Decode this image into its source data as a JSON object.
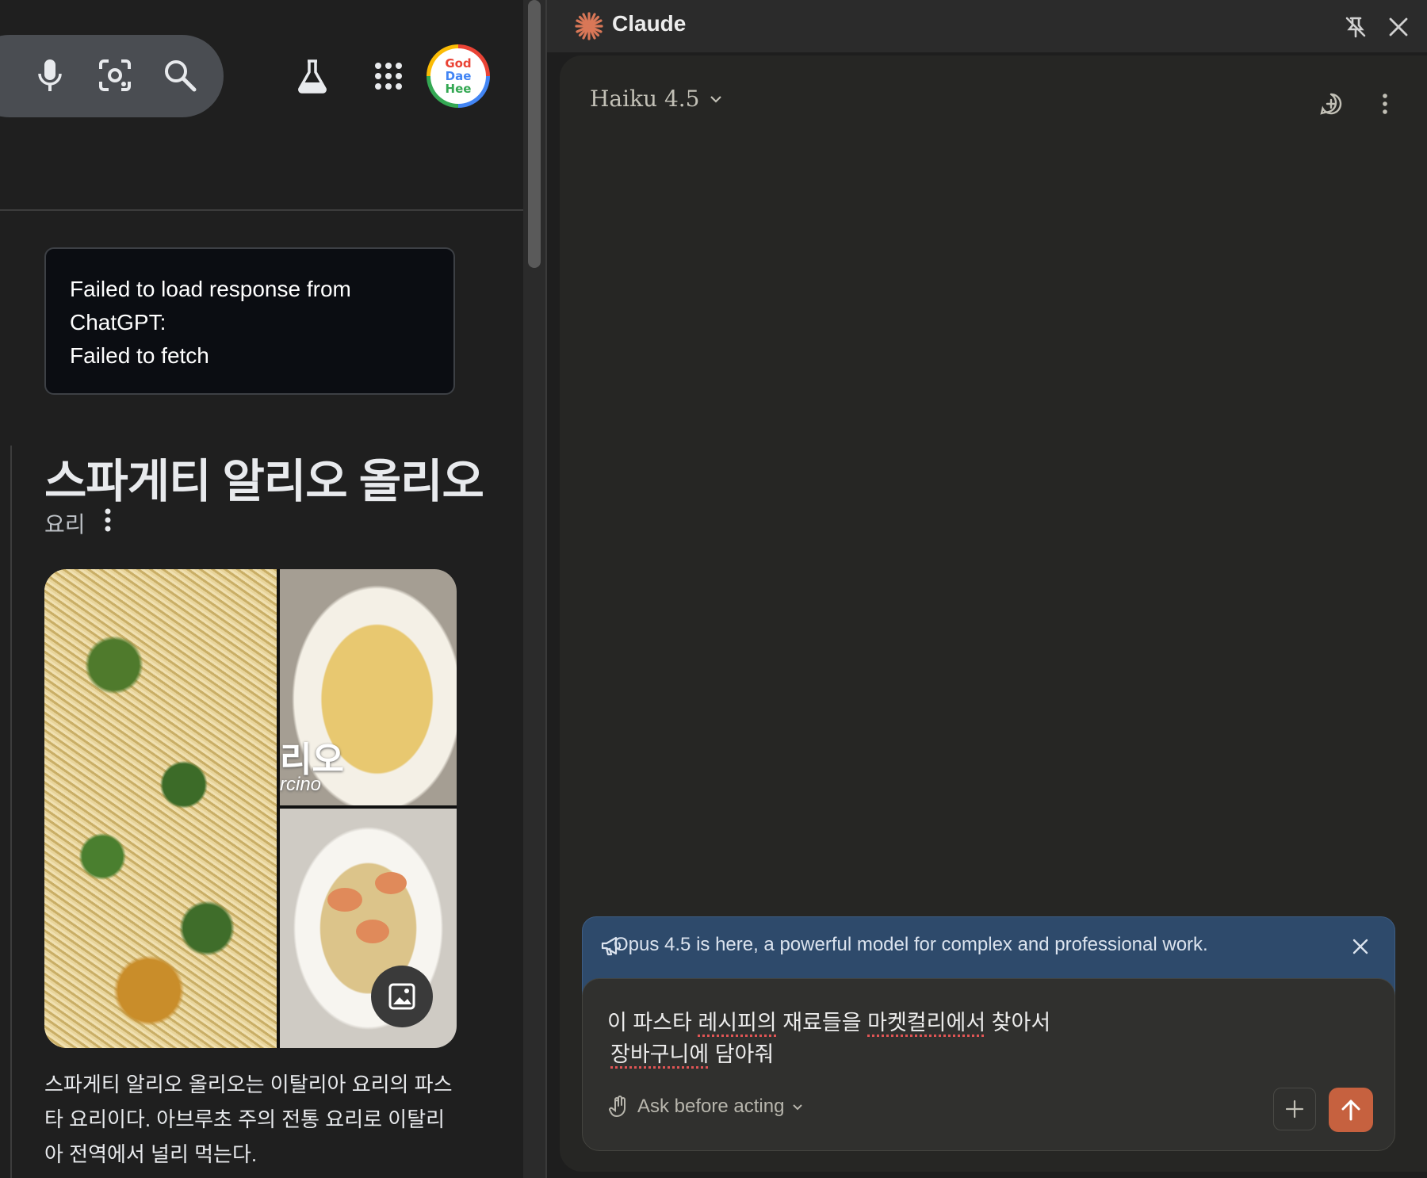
{
  "left_pane": {
    "avatar_lines": [
      "God",
      "Dae",
      "Hee"
    ],
    "error_lines": [
      "Failed to load response from",
      "ChatGPT:",
      "Failed to fetch"
    ],
    "knowledge_panel": {
      "title": "스파게티 알리오 올리오",
      "subtitle": "요리",
      "image_overlay_text": "리오",
      "image_overlay_subtext": "rcino",
      "description": "스파게티 알리오 올리오는 이탈리아 요리의 파스타 요리이다. 아브루초 주의 전통 요리로 이탈리아 전역에서 널리 먹는다."
    },
    "icons": [
      "mic-icon",
      "lens-icon",
      "search-icon",
      "labs-icon",
      "apps-icon"
    ]
  },
  "claude_panel": {
    "title": "Claude",
    "model_name": "Haiku 4.5",
    "banner_text": "Opus 4.5 is here, a powerful model for complex and professional work.",
    "prompt_lines": [
      [
        "이 파스타 ",
        "레시피의",
        " 재료들을 ",
        "마켓컬리에서",
        " 찾아서"
      ],
      [
        "",
        "장바구니에",
        " 담아줘"
      ]
    ],
    "mode_label": "Ask before acting",
    "accent_color": "#c6613f",
    "banner_color": "#2e4a6b"
  }
}
